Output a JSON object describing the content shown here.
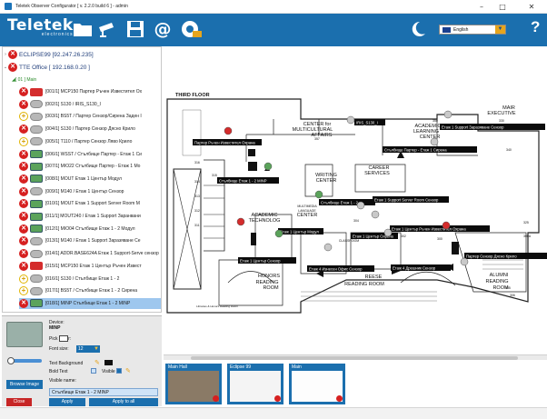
{
  "window": {
    "title": "Teletek Observer Configurator [ v. 2.2.0 build 6 ] - admin",
    "minimize": "–",
    "maximize": "□",
    "close": "✕"
  },
  "toolbar": {
    "logo_main": "Teletek",
    "logo_sub": "electronics",
    "icons": [
      "folder-icon",
      "camera-icon",
      "save-icon",
      "email-icon",
      "panel-settings-icon",
      "night-mode-icon"
    ],
    "language": "English",
    "help": "?"
  },
  "tree": {
    "panels": [
      {
        "name": "ECLIPSE99 [92.247.26.235]"
      },
      {
        "name": "TTE Office [ 192.168.0.20 ]"
      }
    ],
    "group": "[ 01 ] Main",
    "items": [
      {
        "text": "[001/1] MCP150 Партер Ръчен Известител Ох",
        "status": "x",
        "dev": "red"
      },
      {
        "text": "[002/1] S130 / IRIS_S130_I",
        "status": "x",
        "dev": "grey"
      },
      {
        "text": "[003/1] BS5T / Партер Сензор/Сирена Заден I",
        "status": "plus",
        "dev": "grey"
      },
      {
        "text": "[004/1] S130 / Партер Сензор Дясно Крило",
        "status": "x",
        "dev": "grey"
      },
      {
        "text": "[005/1] T110 / Партер Сензор Ляво Крило",
        "status": "plus",
        "dev": "grey"
      },
      {
        "text": "[006/1] WSST / Стълбище Партер - Етаж 1 Си",
        "status": "x",
        "dev": "green"
      },
      {
        "text": "[007/1] MIO22 Стълбище Партер - Етаж 1 Мо",
        "status": "x",
        "dev": "green"
      },
      {
        "text": "[008/1] MOUT Етаж 1 Център Модул",
        "status": "x",
        "dev": "green"
      },
      {
        "text": "[009/1] M140 / Етаж 1 Център Сензор",
        "status": "x",
        "dev": "grey"
      },
      {
        "text": "[010/1] MOUT Етаж 1 Support Server Room M",
        "status": "x",
        "dev": "green"
      },
      {
        "text": "[011/1] MOUT240 / Етаж 1 Support Заранвани",
        "status": "x",
        "dev": "green"
      },
      {
        "text": "[012/1] MIO04 Стълбище Етаж 1 - 2 Модул",
        "status": "x",
        "dev": "green"
      },
      {
        "text": "[013/1] M140 / Етаж 1 Support Заразяване Се",
        "status": "x",
        "dev": "grey"
      },
      {
        "text": "[014/1] ADDR.BASE624A Етаж 1 Support-Serve сензор",
        "status": "x",
        "dev": "grey"
      },
      {
        "text": "[015/1] MCP150 Етаж 1 Център Ръчен Извест",
        "status": "x",
        "dev": "red"
      },
      {
        "text": "[016/1] S130 / Стълбище Етаж 1 - 2",
        "status": "plus",
        "dev": "grey"
      },
      {
        "text": "[017/1] BS5T / Стълбище Етаж 1 - 2 Сирена",
        "status": "plus",
        "dev": "grey"
      },
      {
        "text": "[018/1] MINP Стълбище Етаж 1 - 2 MINP",
        "status": "x",
        "dev": "green",
        "selected": true
      }
    ]
  },
  "props": {
    "device_label": "Device:",
    "device_name": "MINP",
    "pick_color_label": "Pick Color:",
    "font_size_label": "Font size:",
    "font_size": "12",
    "text_bg_label": "Text Background",
    "bold_label": "Bold Text",
    "visible_label": "Visible",
    "visible_name_label": "Visible name:",
    "browse_label": "Browse Image",
    "visible_name": "Стълбище Етаж 1 - 2 MINP",
    "close_label": "Close",
    "apply_label": "Apply",
    "apply_all_label": "Apply to all"
  },
  "map": {
    "floor_label": "THIRD FLOOR",
    "rooms": [
      {
        "text": "CENTER for"
      },
      {
        "text": "MULTICULTURAL"
      },
      {
        "text": "AFFAIRS"
      },
      {
        "text": "ACADEMIC"
      },
      {
        "text": "LEARNING"
      },
      {
        "text": "CENTER"
      },
      {
        "text": "MAIR"
      },
      {
        "text": "EXECUTIVE"
      },
      {
        "text": "WRITING"
      },
      {
        "text": "CENTER"
      },
      {
        "text": "CAREER"
      },
      {
        "text": "SERVICES"
      },
      {
        "text": "ACADEMIC"
      },
      {
        "text": "TECHNOLOG"
      },
      {
        "text": "MULTIMEDIA"
      },
      {
        "text": "LANGUAGE"
      },
      {
        "text": "CENTER"
      },
      {
        "text": "CLASSROOM"
      },
      {
        "text": "CLASSROOM"
      },
      {
        "text": "HONORS"
      },
      {
        "text": "READING"
      },
      {
        "text": "ROOM"
      },
      {
        "text": "REESE"
      },
      {
        "text": "READING ROOM"
      },
      {
        "text": "ALUMNI"
      },
      {
        "text": "READING"
      },
      {
        "text": "ROOM"
      },
      {
        "text": "Libraries & Honors Reading Room"
      }
    ],
    "room_numbers": [
      "316",
      "314",
      "313",
      "312",
      "311",
      "315",
      "357",
      "302",
      "304",
      "300",
      "305",
      "306",
      "300A",
      "325",
      "350",
      "330",
      "340"
    ],
    "labels": [
      {
        "text": "Партер Ръчен Известител Охрана"
      },
      {
        "text": "IRIS_S130_I"
      },
      {
        "text": "Етаж 1 Support Заразяване Сензор"
      },
      {
        "text": "Стълбище Партер - Етаж 1 Сирена"
      },
      {
        "text": "Стълбище Етаж 1 - 2 MINP"
      },
      {
        "text": "Стълбище Етаж 1 - 2"
      },
      {
        "text": "Етаж 1 Support Server Room Сензор"
      },
      {
        "text": "Етаж 1 Център Модул"
      },
      {
        "text": "Етаж 1 Център Сирена"
      },
      {
        "text": "Етаж 1 Център Ръчен Известител Охрана"
      },
      {
        "text": "Етаж 1 Център Сензор"
      },
      {
        "text": "Етаж 4 Изнесен Офис Сензор"
      },
      {
        "text": "Етаж 4 Дрешник Сензор"
      },
      {
        "text": "Партер Сензор Дясно Крило"
      }
    ]
  },
  "thumbnails": [
    {
      "caption": "Main Hall"
    },
    {
      "caption": "Eclipse 99"
    },
    {
      "caption": "Main"
    }
  ],
  "colors": {
    "brand": "#1b6fae",
    "selected": "#9ec7ee",
    "alarm": "#d62020",
    "warning": "#e0b400"
  }
}
